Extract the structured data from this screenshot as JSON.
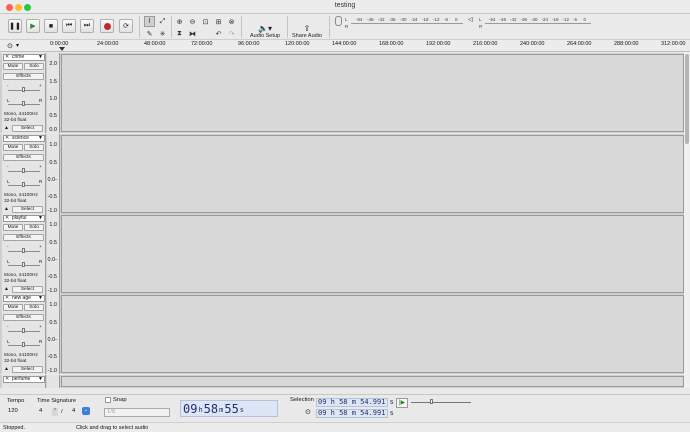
{
  "window": {
    "title": "testing"
  },
  "colors": {
    "close": "#fe5f57",
    "minimize": "#febc2e",
    "zoom": "#28c840",
    "record": "#c0282d",
    "time_bg": "#dde6f5",
    "time_fg": "#24306a"
  },
  "toolbar": {
    "audio_setup_label": "Audio Setup",
    "share_audio_label": "Share Audio",
    "rec_meter_label": "R",
    "play_meter_label": "R",
    "meter_l_label": "L",
    "rec_meter_ticks": [
      "-54",
      "-48",
      "-42",
      "-36",
      "-30",
      "-24",
      "-18",
      "-12",
      "-6",
      "0"
    ],
    "play_meter_ticks": [
      "-54",
      "-48",
      "-42",
      "-36",
      "-30",
      "-24",
      "-18",
      "-12",
      "-6",
      "0"
    ]
  },
  "ruler": {
    "ticks": [
      "0:00:00",
      "24:00:00",
      "48:00:00",
      "72:00:00",
      "96:00:00",
      "120:00:00",
      "144:00:00",
      "168:00:00",
      "192:00:00",
      "216:00:00",
      "240:00:00",
      "264:00:00",
      "288:00:00",
      "312:00:00"
    ]
  },
  "track_controls": {
    "mute": "Mute",
    "solo": "Solo",
    "effects": "Effects",
    "select": "Select",
    "pan_l": "L",
    "pan_r": "R",
    "gain_minus": "-",
    "gain_plus": "+"
  },
  "tracks": [
    {
      "name": "crime",
      "info1": "Mono, 44100Hz",
      "info2": "32-bit float",
      "scale": [
        "2.0",
        "1.5",
        "1.0",
        "0.5",
        "0.0"
      ]
    },
    {
      "name": "science",
      "info1": "Mono, 44100Hz",
      "info2": "32-bit float",
      "scale": [
        "1.0",
        "0.5",
        "0.0-",
        "-0.5",
        "-1.0"
      ]
    },
    {
      "name": "playful",
      "info1": "Mono, 44100Hz",
      "info2": "32-bit float",
      "scale": [
        "1.0",
        "0.5",
        "0.0-",
        "-0.5",
        "-1.0"
      ]
    },
    {
      "name": "new age",
      "info1": "Mono, 44100Hz",
      "info2": "32-bit float",
      "scale": [
        "1.0",
        "0.5",
        "0.0-",
        "-0.5",
        "-1.0"
      ]
    },
    {
      "name": "perfume"
    }
  ],
  "bottom": {
    "tempo_label": "Tempo",
    "tempo_value": "120",
    "time_signature_label": "Time Signature",
    "ts_numerator": "4",
    "ts_slash": "/",
    "ts_denominator": "4",
    "snap_label": "Snap",
    "snap_value": "1/8",
    "time": {
      "h": "09",
      "h_u": "h",
      "m": "58",
      "m_u": "m",
      "s": "55",
      "s_u": "s"
    },
    "selection_label": "Selection",
    "selection_start": "09 h 58 m 54.991 s",
    "selection_end": "09 h 58 m 54.991 s"
  },
  "status": {
    "state": "Stopped.",
    "hint": "Click and drag to select audio"
  }
}
